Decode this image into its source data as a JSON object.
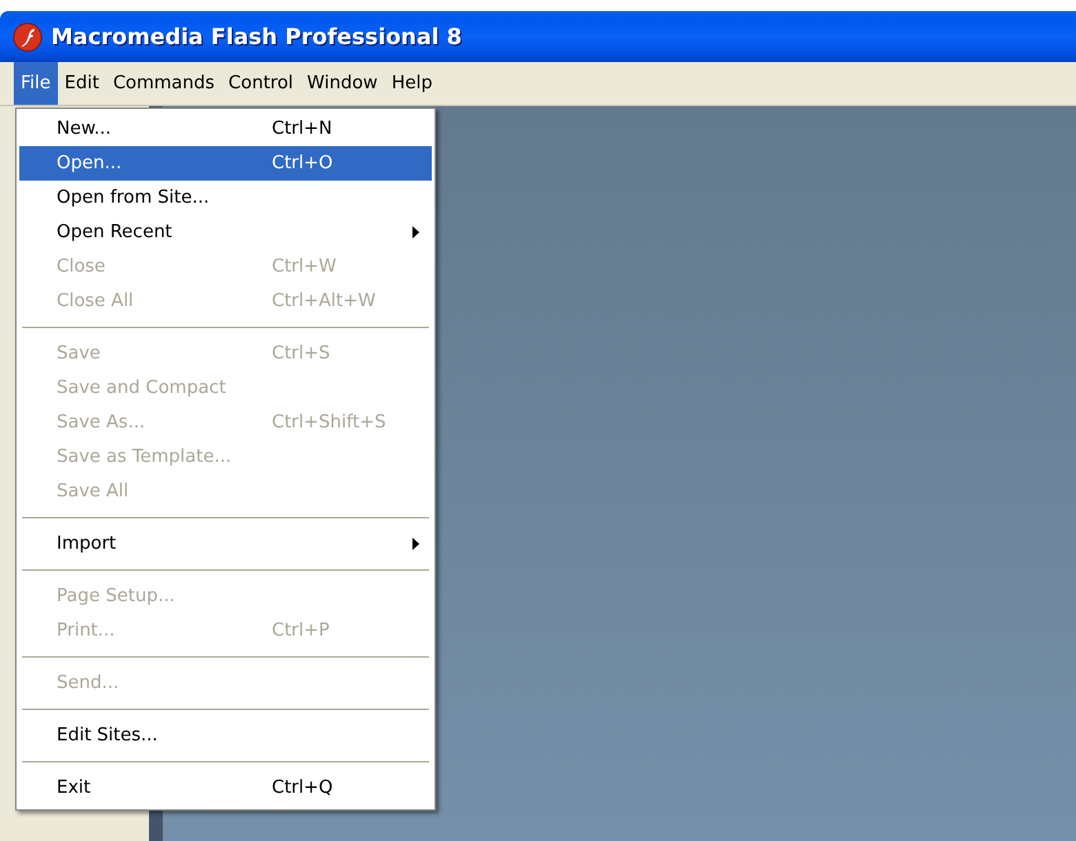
{
  "window": {
    "title": "Macromedia Flash Professional 8"
  },
  "menubar": [
    {
      "label": "File",
      "selected": true
    },
    {
      "label": "Edit",
      "selected": false
    },
    {
      "label": "Commands",
      "selected": false
    },
    {
      "label": "Control",
      "selected": false
    },
    {
      "label": "Window",
      "selected": false
    },
    {
      "label": "Help",
      "selected": false
    }
  ],
  "file_menu": [
    {
      "kind": "item",
      "label": "New...",
      "shortcut": "Ctrl+N",
      "disabled": false,
      "selected": false,
      "submenu": false
    },
    {
      "kind": "item",
      "label": "Open...",
      "shortcut": "Ctrl+O",
      "disabled": false,
      "selected": true,
      "submenu": false
    },
    {
      "kind": "item",
      "label": "Open from Site...",
      "disabled": false,
      "selected": false,
      "submenu": false
    },
    {
      "kind": "item",
      "label": "Open Recent",
      "disabled": false,
      "selected": false,
      "submenu": true
    },
    {
      "kind": "item",
      "label": "Close",
      "shortcut": "Ctrl+W",
      "disabled": true,
      "selected": false,
      "submenu": false
    },
    {
      "kind": "item",
      "label": "Close All",
      "shortcut": "Ctrl+Alt+W",
      "disabled": true,
      "selected": false,
      "submenu": false
    },
    {
      "kind": "separator"
    },
    {
      "kind": "item",
      "label": "Save",
      "shortcut": "Ctrl+S",
      "disabled": true,
      "selected": false,
      "submenu": false
    },
    {
      "kind": "item",
      "label": "Save and Compact",
      "disabled": true,
      "selected": false,
      "submenu": false
    },
    {
      "kind": "item",
      "label": "Save As...",
      "shortcut": "Ctrl+Shift+S",
      "disabled": true,
      "selected": false,
      "submenu": false
    },
    {
      "kind": "item",
      "label": "Save as Template...",
      "disabled": true,
      "selected": false,
      "submenu": false
    },
    {
      "kind": "item",
      "label": "Save All",
      "disabled": true,
      "selected": false,
      "submenu": false
    },
    {
      "kind": "separator"
    },
    {
      "kind": "item",
      "label": "Import",
      "disabled": false,
      "selected": false,
      "submenu": true
    },
    {
      "kind": "separator"
    },
    {
      "kind": "item",
      "label": "Page Setup...",
      "disabled": true,
      "selected": false,
      "submenu": false
    },
    {
      "kind": "item",
      "label": "Print...",
      "shortcut": "Ctrl+P",
      "disabled": true,
      "selected": false,
      "submenu": false
    },
    {
      "kind": "separator"
    },
    {
      "kind": "item",
      "label": "Send...",
      "disabled": true,
      "selected": false,
      "submenu": false
    },
    {
      "kind": "separator"
    },
    {
      "kind": "item",
      "label": "Edit Sites...",
      "disabled": false,
      "selected": false,
      "submenu": false
    },
    {
      "kind": "separator"
    },
    {
      "kind": "item",
      "label": "Exit",
      "shortcut": "Ctrl+Q",
      "disabled": false,
      "selected": false,
      "submenu": false
    }
  ]
}
